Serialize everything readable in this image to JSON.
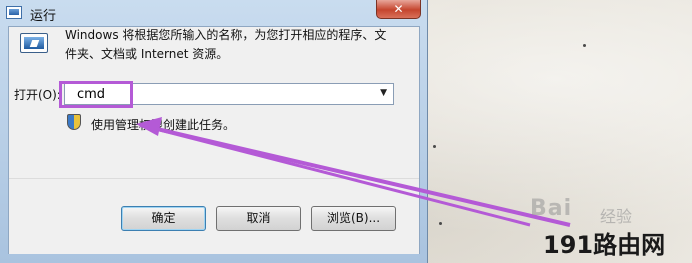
{
  "window": {
    "title": "运行",
    "close_label": "✕"
  },
  "main": {
    "description": "Windows 将根据您所输入的名称，为您打开相应的程序、文件夹、文档或 Internet 资源。",
    "open_label": "打开(O):",
    "command_value": "cmd",
    "admin_note": "使用管理权限创建此任务。"
  },
  "buttons": {
    "ok": "确定",
    "cancel": "取消",
    "browse": "浏览(B)..."
  },
  "overlay": {
    "watermark": "Bai",
    "watermark_sub": "经验",
    "site": "191路由网"
  },
  "colors": {
    "highlight": "#b45ad6",
    "arrow": "#b45ad6"
  }
}
